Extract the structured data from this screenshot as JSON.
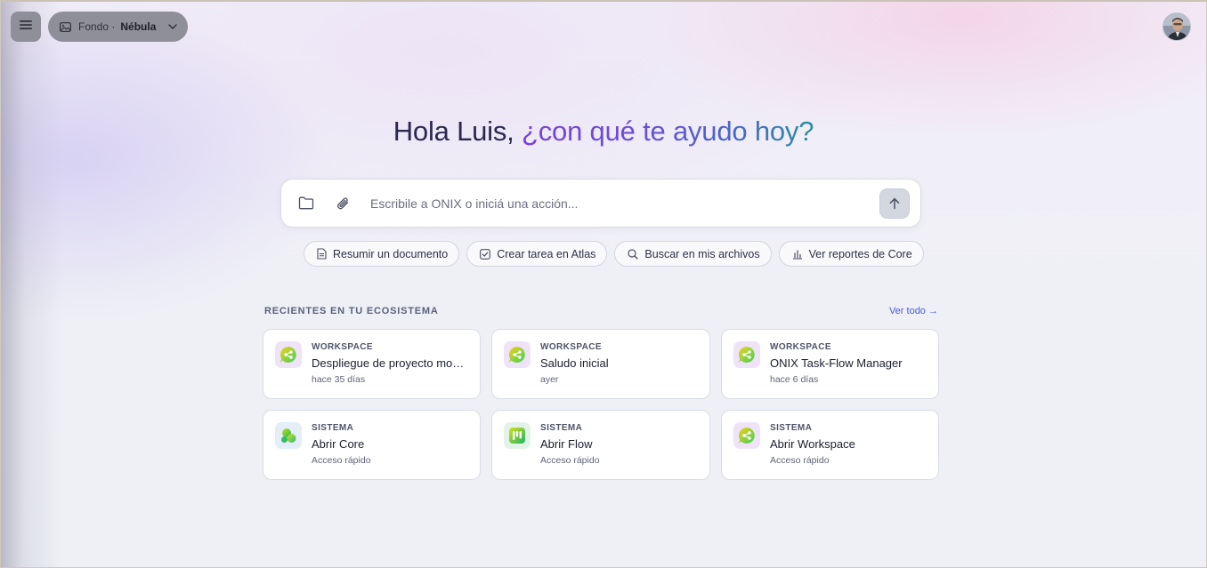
{
  "header": {
    "background_label": "Fondo ·",
    "background_value": "Nébula"
  },
  "greeting": {
    "part1": "Hola Luis,",
    "part2": "¿con qué te ayudo hoy?"
  },
  "composer": {
    "placeholder": "Escribile a ONIX o iniciá una acción..."
  },
  "quick_actions": [
    {
      "label": "Resumir un documento",
      "icon": "document-icon"
    },
    {
      "label": "Crear tarea en Atlas",
      "icon": "checkbox-icon"
    },
    {
      "label": "Buscar en mis archivos",
      "icon": "search-icon"
    },
    {
      "label": "Ver reportes de Core",
      "icon": "bar-chart-icon"
    }
  ],
  "recents": {
    "title": "RECIENTES EN TU ECOSISTEMA",
    "see_all": "Ver todo →",
    "items": [
      {
        "kind": "WORKSPACE",
        "name": "Despliegue de proyecto monorepo",
        "meta": "hace 35 días",
        "icon": "workspace-icon"
      },
      {
        "kind": "WORKSPACE",
        "name": "Saludo inicial",
        "meta": "ayer",
        "icon": "workspace-icon"
      },
      {
        "kind": "WORKSPACE",
        "name": "ONIX Task-Flow Manager",
        "meta": "hace 6 días",
        "icon": "workspace-icon"
      },
      {
        "kind": "SISTEMA",
        "name": "Abrir Core",
        "meta": "Acceso rápido",
        "icon": "core-icon"
      },
      {
        "kind": "SISTEMA",
        "name": "Abrir Flow",
        "meta": "Acceso rápido",
        "icon": "flow-icon"
      },
      {
        "kind": "SISTEMA",
        "name": "Abrir Workspace",
        "meta": "Acceso rápido",
        "icon": "workspace-icon"
      }
    ]
  },
  "colors": {
    "accent": "#4b5bd0",
    "greeting_gradient_start": "#7b3fd8",
    "greeting_gradient_end": "#2a8f9e"
  }
}
